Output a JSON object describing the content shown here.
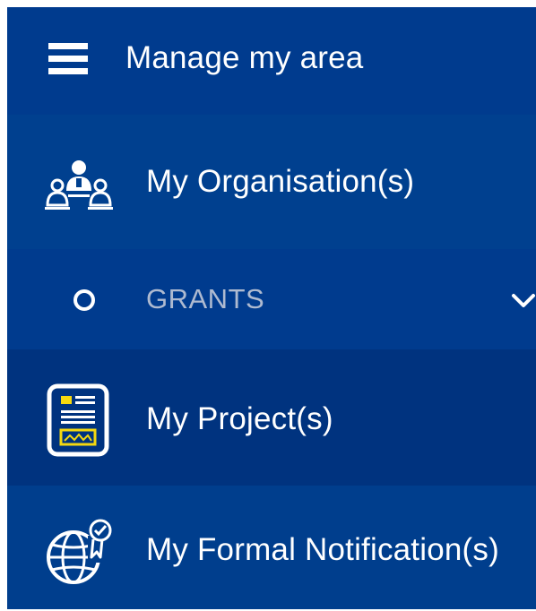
{
  "header": {
    "title": "Manage my area",
    "menu_icon": "hamburger-menu-icon"
  },
  "menu": {
    "organisations": {
      "label": "My Organisation(s)",
      "icon": "organisation-people-icon"
    },
    "grants": {
      "label": "GRANTS",
      "icon": "circle-bullet-icon",
      "expand_icon": "chevron-down-icon"
    },
    "projects": {
      "label": "My Project(s)",
      "icon": "project-document-icon"
    },
    "notifications": {
      "label": "My Formal Notification(s)",
      "icon": "globe-certificate-icon"
    }
  },
  "colors": {
    "header_bg": "#003b8e",
    "row_bg": "#00408f",
    "active_row_bg": "#00337f",
    "text": "#ffffff",
    "section_text": "#aebad0",
    "accent_yellow": "#f5d80f"
  }
}
